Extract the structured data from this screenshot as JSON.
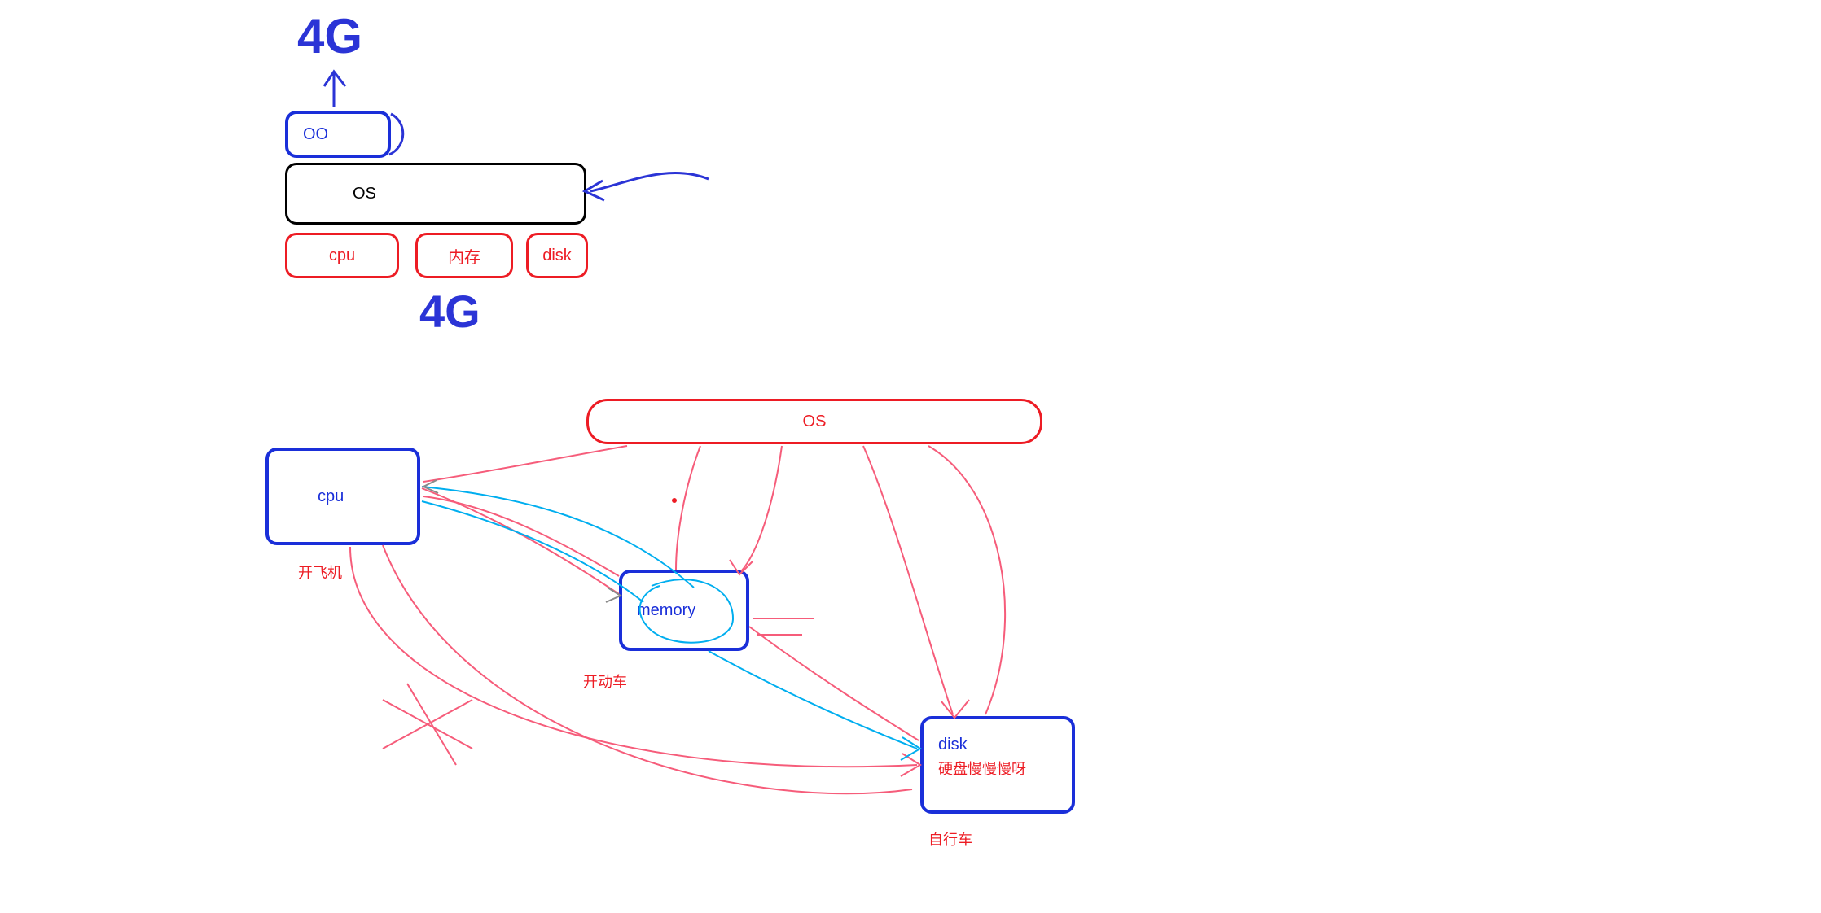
{
  "top": {
    "annotation_top": "4G",
    "oo_label": "OO",
    "os_label": "OS",
    "cpu_label": "cpu",
    "mem_label": "内存",
    "disk_label": "disk",
    "annotation_bottom": "4G"
  },
  "bottom": {
    "os_label": "OS",
    "cpu_label": "cpu",
    "cpu_caption": "开飞机",
    "mem_label": "memory",
    "mem_caption": "开动车",
    "disk_label": "disk",
    "disk_inner": "硬盘慢慢慢呀",
    "disk_caption": "自行车"
  },
  "colors": {
    "blue": "#1a2fd9",
    "red": "#ed1c24",
    "black": "#000000",
    "cyan": "#00aeef",
    "pink": "#f65c7a",
    "ink": "#2b34d6"
  }
}
